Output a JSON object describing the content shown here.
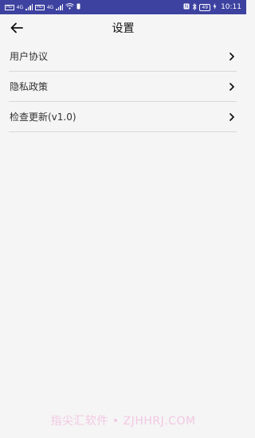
{
  "status_bar": {
    "left_tag_1": "HD",
    "left_tag_2": "HD",
    "net_1": "4G",
    "net_2": "4G",
    "battery": "49",
    "time": "10:11"
  },
  "header": {
    "title": "设置"
  },
  "menu": {
    "items": [
      {
        "label": "用户协议"
      },
      {
        "label": "隐私政策"
      },
      {
        "label": "检查更新(v1.0)"
      }
    ]
  },
  "watermark": "指尖汇软件 • ZJHHRJ.COM"
}
